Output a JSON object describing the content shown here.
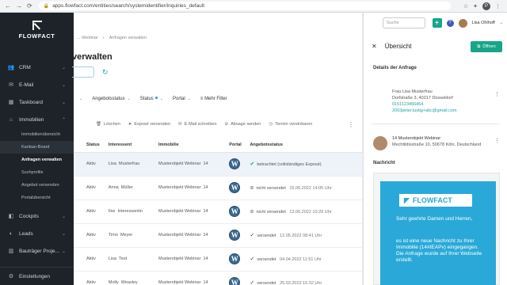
{
  "browser": {
    "url": "apps.flowfact.com/entities/search/systemidentifier/inquiries_default"
  },
  "sidebar": {
    "brand": "FLOWFACT",
    "items": [
      {
        "label": "CRM",
        "icon": "people-icon"
      },
      {
        "label": "E-Mail",
        "icon": "mail-icon"
      },
      {
        "label": "Taskboard",
        "icon": "board-icon"
      },
      {
        "label": "Immobilien",
        "icon": "house-icon"
      }
    ],
    "sub_items": [
      "Immobilienübersicht",
      "Kanban-Board",
      "Anfragen verwalten",
      "Suchprofile",
      "Angebot versenden",
      "Portalübersicht"
    ],
    "lower_items": [
      {
        "label": "Cockpits",
        "icon": "dashboard-icon"
      },
      {
        "label": "Leads",
        "icon": "leads-icon"
      },
      {
        "label": "Bauträger Proje...",
        "icon": "building-icon"
      }
    ],
    "settings": "Einstellungen"
  },
  "main": {
    "breadcrumb": [
      "...-Webinar",
      "Anfragen verwalten"
    ],
    "title": "verwalten",
    "filters": [
      "Angebotsstatus",
      "Status",
      "Portal",
      "Mehr Filter"
    ],
    "actions": [
      "Löschen",
      "Exposé versenden",
      "E-Mail schreiben",
      "Absage senden",
      "Termin vereinbaren"
    ],
    "columns": [
      "Status",
      "Interessent",
      "Immobilie",
      "Portal",
      "Angebotsstatus"
    ],
    "rows": [
      {
        "status": "Aktiv",
        "first": "Lisa",
        "last": "Musterfrau",
        "property": "Musterobjekt Webinar",
        "num": "14",
        "offer": "betrachtet (vollständiges Exposé)",
        "date": "",
        "offer_icon": "ok"
      },
      {
        "status": "Aktiv",
        "first": "Anna",
        "last": "Müller",
        "property": "Musterobjekt Webinar",
        "num": "14",
        "offer": "nicht versendet",
        "date": "15.06.2022 14:05 Uhr",
        "offer_icon": "no"
      },
      {
        "status": "Aktiv",
        "first": "Ilse",
        "last": "Interessentin",
        "property": "Musterobjekt Webinar",
        "num": "14",
        "offer": "nicht versendet",
        "date": "13.06.2022 10:29 Uhr",
        "offer_icon": "no"
      },
      {
        "status": "Aktiv",
        "first": "Timo",
        "last": "Meyer",
        "property": "Musterobjekt Webinar",
        "num": "14",
        "offer": "versendet",
        "date": "12.05.2022 08:41 Uhr",
        "offer_icon": "check"
      },
      {
        "status": "Aktiv",
        "first": "Lisa",
        "last": "Test",
        "property": "Musterobjekt Webinar",
        "num": "14",
        "offer": "versendet",
        "date": "04.04.2022 11:51 Uhr",
        "offer_icon": "check"
      },
      {
        "status": "Aktiv",
        "first": "Molly",
        "last": "Weasley",
        "property": "Musterobjekt Webinar",
        "num": "14",
        "offer": "versendet",
        "date": "25.03.2022 15:32 Uhr",
        "offer_icon": "check"
      }
    ]
  },
  "topbar": {
    "search_placeholder": "Suche",
    "user": "Lisa Ohlhoff"
  },
  "panel": {
    "title": "Übersicht",
    "open_label": "Öffnen",
    "details_title": "Details der Anfrage",
    "contact": {
      "name": "Frau Lisa Musterfrau",
      "address": "Dorfstraße 3, 40217 Düsseldorf",
      "phone": "0151123456464",
      "email": "2003peter.lustig+abc@gmail.com"
    },
    "property": {
      "name": "14 Musterobjekt Webinar",
      "address": "Mechtildisstraße 10, 50678 Köln, Deutschland"
    },
    "message_title": "Nachricht",
    "mail": {
      "logo": "FLOWFACT",
      "greeting": "Sehr geehrte Damen und Herren,",
      "body": "es ist eine neue Nachricht zu Ihrer Immobilie (14#IEAPv) eingegangen. Die Anfrage wurde auf Ihrer Webseite erstellt."
    }
  },
  "colors": {
    "accent": "#17a589",
    "sidebar_bg": "#1d2329",
    "mail_bg": "#2aa9d8"
  }
}
